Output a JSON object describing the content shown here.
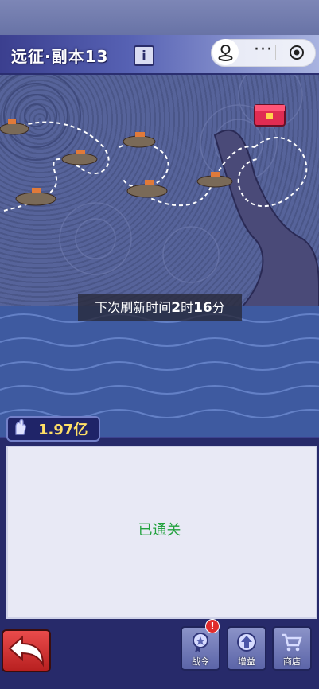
{
  "header": {
    "title": "远征·副本13",
    "info_icon": "info-icon",
    "capsule_icons": [
      "joystick-icon",
      "more-dots-icon",
      "record-target-icon"
    ]
  },
  "map": {
    "refresh_prefix": "下次刷新时间",
    "refresh_hours": "2",
    "refresh_hours_unit": "时",
    "refresh_minutes": "16",
    "refresh_minutes_unit": "分"
  },
  "power": {
    "icon": "fist-icon",
    "value": "1.97亿"
  },
  "panel": {
    "status": "已通关"
  },
  "bottom_nav": {
    "back_icon": "back-arrow-icon",
    "buttons": [
      {
        "label": "战令",
        "icon": "medal-icon",
        "badge": "!"
      },
      {
        "label": "增益",
        "icon": "upgrade-arrow-icon"
      },
      {
        "label": "商店",
        "icon": "cart-icon"
      }
    ]
  },
  "colors": {
    "accent_green": "#23a23f",
    "power_gold": "#ffe066",
    "back_red": "#d83030"
  }
}
